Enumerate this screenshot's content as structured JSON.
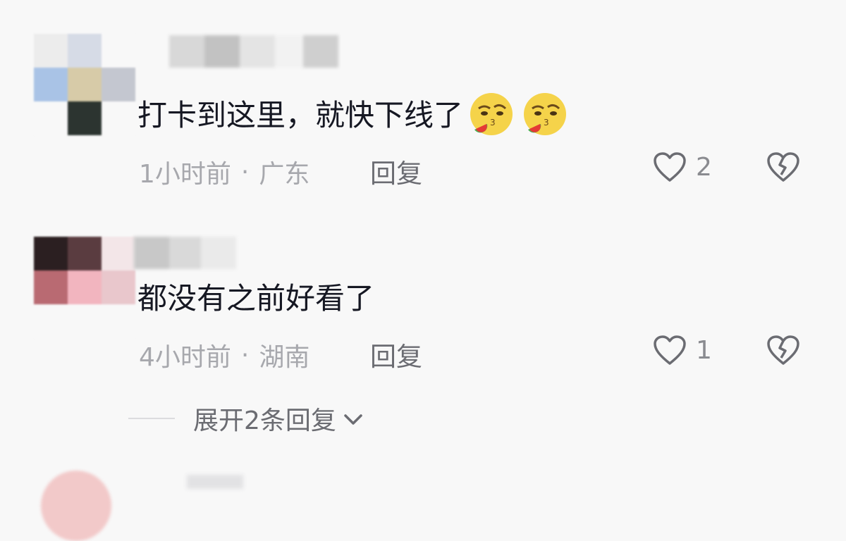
{
  "comments": [
    {
      "text": "打卡到这里，就快下线了",
      "emoji": [
        "smirk-watermelon-icon",
        "smirk-watermelon-icon"
      ],
      "time": "1小时前",
      "separator": "·",
      "location": "广东",
      "reply_label": "回复",
      "like_count": "2"
    },
    {
      "text": "都没有之前好看了",
      "time": "4小时前",
      "separator": "·",
      "location": "湖南",
      "reply_label": "回复",
      "like_count": "1",
      "expand_label": "展开2条回复"
    }
  ],
  "colors": {
    "background": "#f8f8f8",
    "text": "#161823",
    "meta": "#a7a8ad",
    "secondary": "#6b6c72"
  }
}
